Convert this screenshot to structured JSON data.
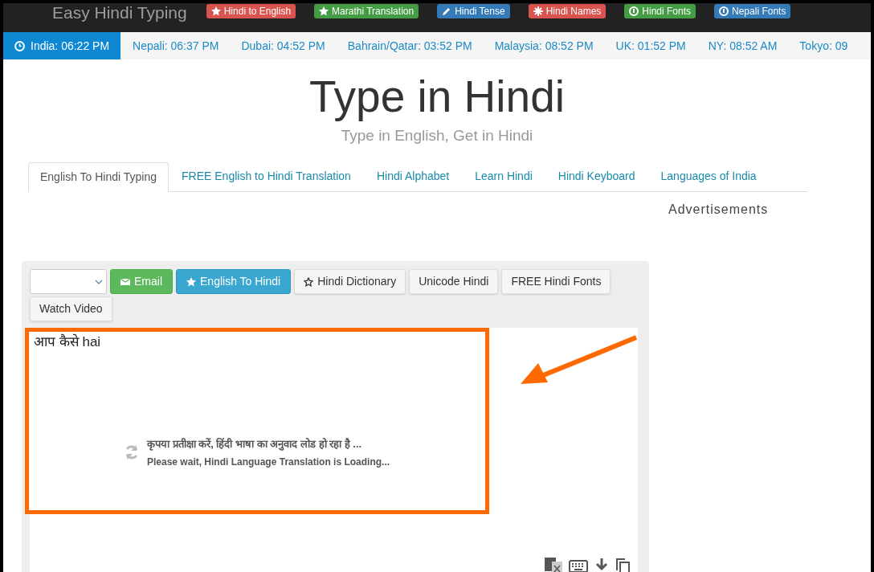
{
  "site_title": "Easy Hindi Typing",
  "nav_badges": [
    {
      "label": "Hindi to English",
      "color": "#d9534f"
    },
    {
      "label": "Marathi Translation",
      "color": "#449d44"
    },
    {
      "label": "Hindi Tense",
      "color": "#337ab7"
    },
    {
      "label": "Hindi Names",
      "color": "#d9534f"
    },
    {
      "label": "Hindi Fonts",
      "color": "#449d44"
    },
    {
      "label": "Nepali Fonts",
      "color": "#337ab7"
    }
  ],
  "time_bar": [
    {
      "label": "India: 06:22 PM",
      "selected": true
    },
    {
      "label": "Nepali: 06:37 PM",
      "selected": false
    },
    {
      "label": "Dubai: 04:52 PM",
      "selected": false
    },
    {
      "label": "Bahrain/Qatar: 03:52 PM",
      "selected": false
    },
    {
      "label": "Malaysia: 08:52 PM",
      "selected": false
    },
    {
      "label": "UK: 01:52 PM",
      "selected": false
    },
    {
      "label": "NY: 08:52 AM",
      "selected": false
    },
    {
      "label": "Tokyo: 09",
      "selected": false
    }
  ],
  "heading": "Type in Hindi",
  "subheading": "Type in English, Get in Hindi",
  "tabs": [
    {
      "label": "English To Hindi Typing",
      "selected": true
    },
    {
      "label": "FREE English to Hindi Translation",
      "selected": false
    },
    {
      "label": "Hindi Alphabet",
      "selected": false
    },
    {
      "label": "Learn Hindi",
      "selected": false
    },
    {
      "label": "Hindi Keyboard",
      "selected": false
    },
    {
      "label": "Languages of India",
      "selected": false
    }
  ],
  "advertisements_label": "Advertisements",
  "toolbar": [
    {
      "kind": "select"
    },
    {
      "kind": "success",
      "label": "Email"
    },
    {
      "kind": "primary",
      "label": "English To Hindi"
    },
    {
      "kind": "default",
      "label": "Hindi Dictionary"
    },
    {
      "kind": "default",
      "label": "Unicode Hindi"
    },
    {
      "kind": "default",
      "label": "FREE Hindi Fonts"
    },
    {
      "kind": "default",
      "label": "Watch Video"
    }
  ],
  "editor": {
    "value": "आप कैसे hai"
  },
  "loading": {
    "hindi": "कृपया प्रतीक्षा करें, हिंदी भाषा का अनुवाद लोड हो रहा है ...",
    "english": "Please wait, Hindi Language Translation is Loading..."
  }
}
